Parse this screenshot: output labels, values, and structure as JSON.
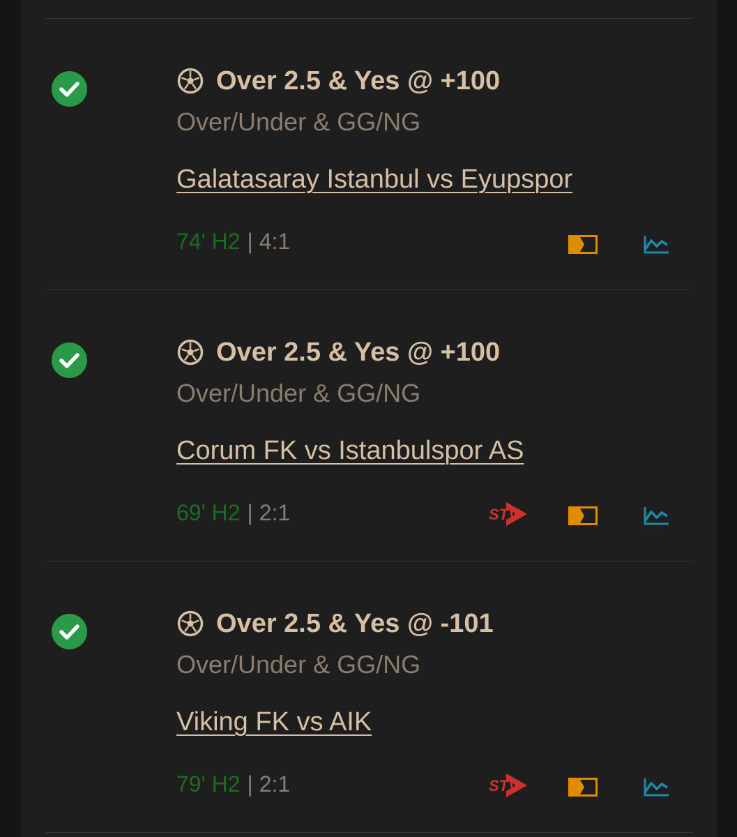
{
  "bets": [
    {
      "status": "won",
      "sport_icon": "soccer-ball-icon",
      "selection": "Over 2.5 & Yes @ +100",
      "market": "Over/Under & GG/NG",
      "match": "Galatasaray Istanbul vs Eyupspor",
      "time": "74' H2",
      "score": "| 4:1",
      "has_stream": false
    },
    {
      "status": "won",
      "sport_icon": "soccer-ball-icon",
      "selection": "Over 2.5 & Yes @ +100",
      "market": "Over/Under & GG/NG",
      "match": "Corum FK vs Istanbulspor AS",
      "time": "69' H2",
      "score": "| 2:1",
      "has_stream": true
    },
    {
      "status": "won",
      "sport_icon": "soccer-ball-icon",
      "selection": "Over 2.5 & Yes @ -101",
      "market": "Over/Under & GG/NG",
      "match": "Viking FK vs AIK",
      "time": "79' H2",
      "score": "| 2:1",
      "has_stream": true
    }
  ],
  "icons": {
    "won": "check-circle-icon",
    "stream": "stv-icon",
    "scoreboard": "scoreboard-icon",
    "stats": "stats-chart-icon"
  },
  "colors": {
    "won_green": "#2a9a48",
    "live_time": "#1d6b1e",
    "selection_text": "#d6bfa4",
    "muted_text": "#8a7c6e",
    "stream_red": "#d0302c",
    "scoreboard_orange": "#e08c00",
    "stats_teal": "#1d8aa8"
  }
}
